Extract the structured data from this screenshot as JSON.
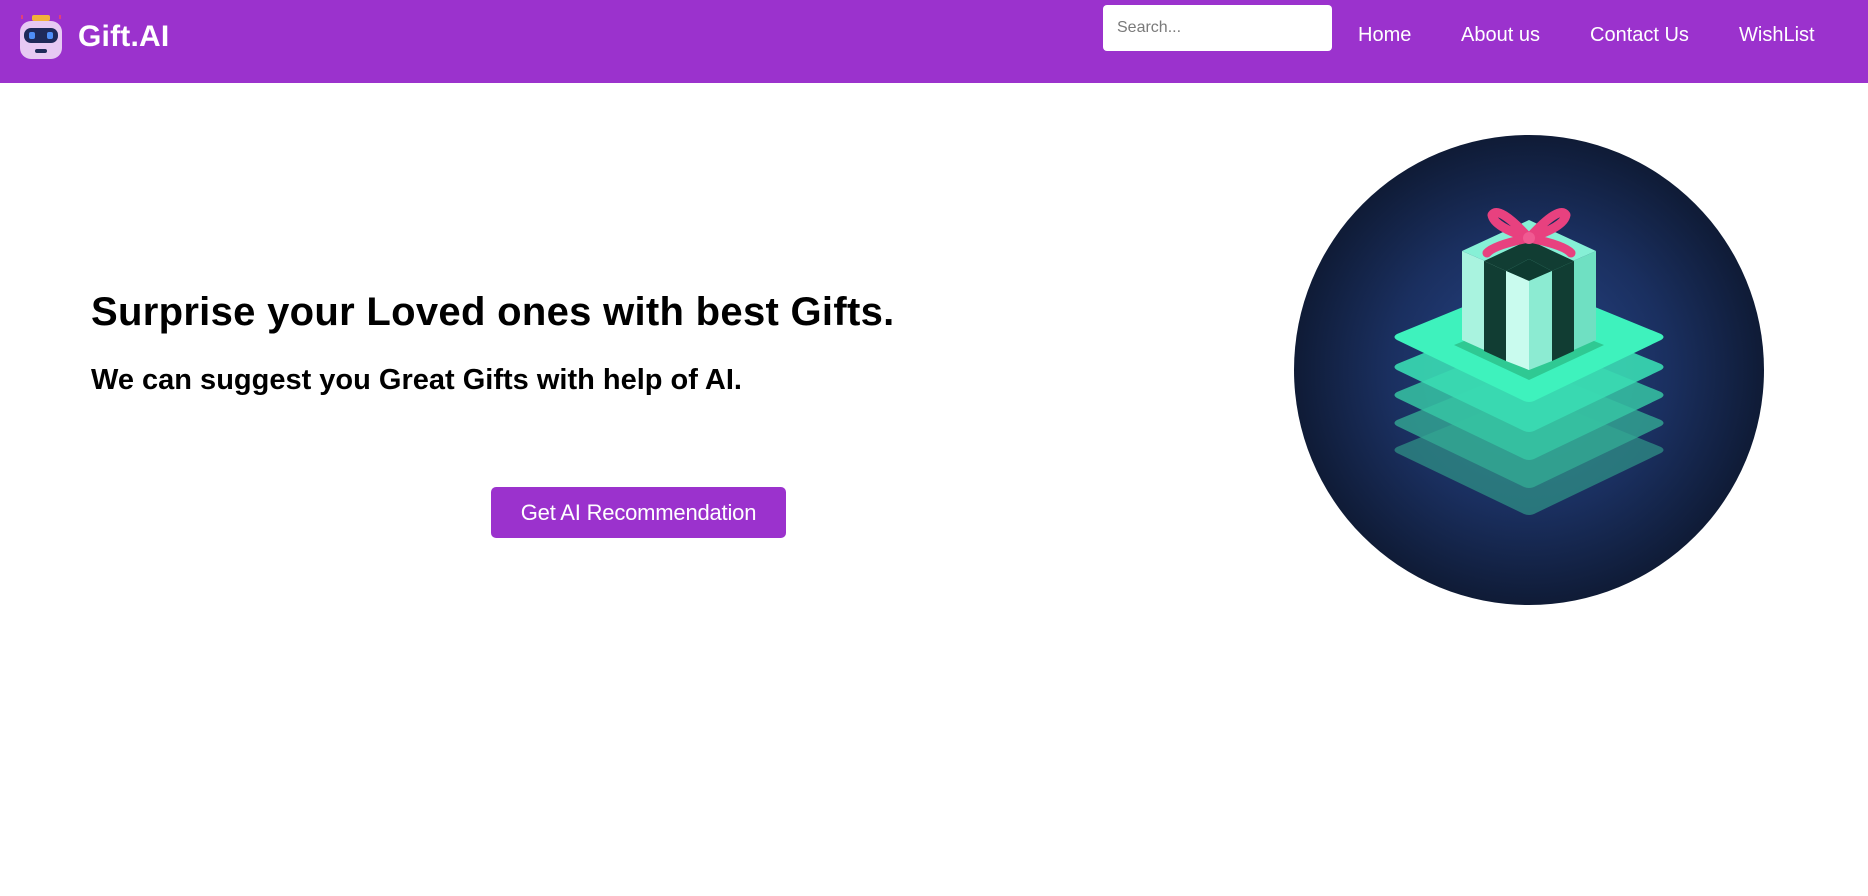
{
  "header": {
    "brand": "Gift.AI",
    "logo_icon": "robot-icon",
    "search": {
      "placeholder": "Search...",
      "value": ""
    },
    "nav": [
      {
        "label": "Home"
      },
      {
        "label": "About us"
      },
      {
        "label": "Contact Us"
      },
      {
        "label": "WishList"
      }
    ]
  },
  "hero": {
    "title": "Surprise your Loved ones with best Gifts.",
    "subtitle": "We can suggest you Great Gifts with help of AI.",
    "cta_label": "Get AI Recommendation",
    "image_icon": "gift-box-illustration"
  },
  "colors": {
    "brand": "#9b32cd",
    "background": "#ffffff",
    "text": "#000000",
    "nav_text": "#ffffff"
  }
}
